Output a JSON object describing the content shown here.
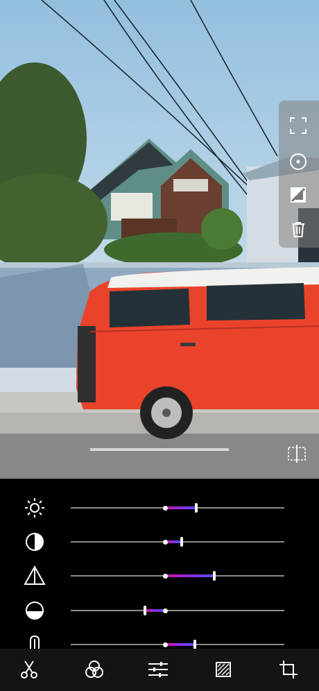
{
  "colors": {
    "accent_start": "#d11aa5",
    "accent_end": "#5a4dff",
    "track": "#8d8d8d",
    "panel_bg": "#000000",
    "nav_bg": "#141414"
  },
  "photo": {
    "description_icon": "photo-preview"
  },
  "side_toolbar": {
    "items": [
      {
        "icon": "crop-frame-icon"
      },
      {
        "icon": "radial-target-icon"
      },
      {
        "icon": "mask-invert-icon"
      },
      {
        "icon": "trash-icon"
      }
    ]
  },
  "compare_button": {
    "icon": "split-compare-icon"
  },
  "adjustments": [
    {
      "icon": "brightness-icon",
      "value": 0.26
    },
    {
      "icon": "contrast-icon",
      "value": 0.14
    },
    {
      "icon": "saturation-icon",
      "value": 0.41
    },
    {
      "icon": "exposure-icon",
      "value": -0.17
    },
    {
      "icon": "temperature-icon",
      "value": 0.25
    }
  ],
  "bottom_nav": {
    "items": [
      {
        "icon": "scissors-icon",
        "active": false
      },
      {
        "icon": "filters-icon",
        "active": false
      },
      {
        "icon": "adjust-sliders-icon",
        "active": true
      },
      {
        "icon": "vignette-icon",
        "active": false
      },
      {
        "icon": "crop-icon",
        "active": false
      }
    ]
  }
}
